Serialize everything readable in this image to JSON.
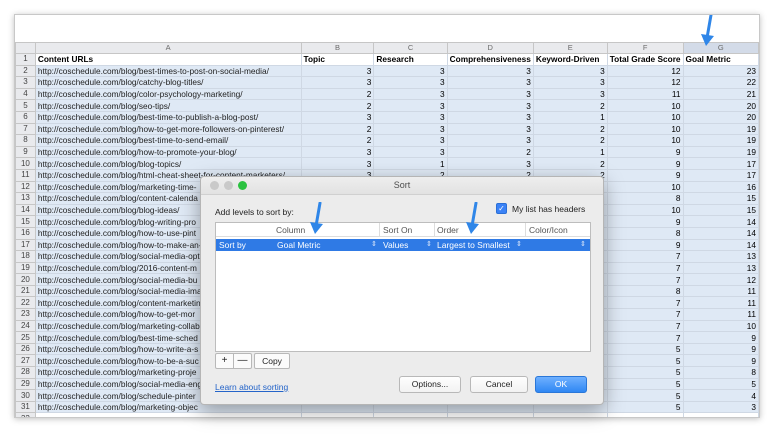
{
  "columns": [
    "A",
    "B",
    "C",
    "D",
    "E",
    "F",
    "G"
  ],
  "header_row": {
    "num": "1",
    "cells": [
      "Content URLs",
      "Topic",
      "Research",
      "Comprehensiveness",
      "Keyword-Driven",
      "Total Grade Score",
      "Goal Metric"
    ]
  },
  "rows": [
    {
      "n": "2",
      "url": "http://coschedule.com/blog/best-times-to-post-on-social-media/",
      "b": "3",
      "c": "3",
      "d": "3",
      "e": "3",
      "f": "12",
      "g": "23"
    },
    {
      "n": "3",
      "url": "http://coschedule.com/blog/catchy-blog-titles/",
      "b": "3",
      "c": "3",
      "d": "3",
      "e": "3",
      "f": "12",
      "g": "22"
    },
    {
      "n": "4",
      "url": "http://coschedule.com/blog/color-psychology-marketing/",
      "b": "2",
      "c": "3",
      "d": "3",
      "e": "3",
      "f": "11",
      "g": "21"
    },
    {
      "n": "5",
      "url": "http://coschedule.com/blog/seo-tips/",
      "b": "2",
      "c": "3",
      "d": "3",
      "e": "2",
      "f": "10",
      "g": "20"
    },
    {
      "n": "6",
      "url": "http://coschedule.com/blog/best-time-to-publish-a-blog-post/",
      "b": "3",
      "c": "3",
      "d": "3",
      "e": "1",
      "f": "10",
      "g": "20"
    },
    {
      "n": "7",
      "url": "http://coschedule.com/blog/how-to-get-more-followers-on-pinterest/",
      "b": "2",
      "c": "3",
      "d": "3",
      "e": "2",
      "f": "10",
      "g": "19"
    },
    {
      "n": "8",
      "url": "http://coschedule.com/blog/best-time-to-send-email/",
      "b": "2",
      "c": "3",
      "d": "3",
      "e": "2",
      "f": "10",
      "g": "19"
    },
    {
      "n": "9",
      "url": "http://coschedule.com/blog/how-to-promote-your-blog/",
      "b": "3",
      "c": "3",
      "d": "2",
      "e": "1",
      "f": "9",
      "g": "19"
    },
    {
      "n": "10",
      "url": "http://coschedule.com/blog/blog-topics/",
      "b": "3",
      "c": "1",
      "d": "3",
      "e": "2",
      "f": "9",
      "g": "17"
    },
    {
      "n": "11",
      "url": "http://coschedule.com/blog/html-cheat-sheet-for-content-marketers/",
      "b": "3",
      "c": "2",
      "d": "2",
      "e": "2",
      "f": "9",
      "g": "17"
    },
    {
      "n": "12",
      "url": "http://coschedule.com/blog/marketing-time-",
      "b": "",
      "c": "",
      "d": "",
      "e": "",
      "f": "10",
      "g": "16"
    },
    {
      "n": "13",
      "url": "http://coschedule.com/blog/content-calenda",
      "b": "",
      "c": "",
      "d": "",
      "e": "",
      "f": "8",
      "g": "15"
    },
    {
      "n": "14",
      "url": "http://coschedule.com/blog/blog-ideas/",
      "b": "",
      "c": "",
      "d": "",
      "e": "",
      "f": "10",
      "g": "15"
    },
    {
      "n": "15",
      "url": "http://coschedule.com/blog/blog-writing-pro",
      "b": "",
      "c": "",
      "d": "",
      "e": "",
      "f": "9",
      "g": "14"
    },
    {
      "n": "16",
      "url": "http://coschedule.com/blog/how-to-use-pint",
      "b": "",
      "c": "",
      "d": "",
      "e": "",
      "f": "8",
      "g": "14"
    },
    {
      "n": "17",
      "url": "http://coschedule.com/blog/how-to-make-an-",
      "b": "",
      "c": "",
      "d": "",
      "e": "",
      "f": "9",
      "g": "14"
    },
    {
      "n": "18",
      "url": "http://coschedule.com/blog/social-media-opt",
      "b": "",
      "c": "",
      "d": "",
      "e": "",
      "f": "7",
      "g": "13"
    },
    {
      "n": "19",
      "url": "http://coschedule.com/blog/2016-content-m",
      "b": "",
      "c": "",
      "d": "",
      "e": "",
      "f": "7",
      "g": "13"
    },
    {
      "n": "20",
      "url": "http://coschedule.com/blog/social-media-bu",
      "b": "",
      "c": "",
      "d": "",
      "e": "",
      "f": "7",
      "g": "12"
    },
    {
      "n": "21",
      "url": "http://coschedule.com/blog/social-media-ima",
      "b": "",
      "c": "",
      "d": "",
      "e": "",
      "f": "8",
      "g": "11"
    },
    {
      "n": "22",
      "url": "http://coschedule.com/blog/content-marketin",
      "b": "",
      "c": "",
      "d": "",
      "e": "",
      "f": "7",
      "g": "11"
    },
    {
      "n": "23",
      "url": "http://coschedule.com/blog/how-to-get-mor",
      "b": "",
      "c": "",
      "d": "",
      "e": "",
      "f": "7",
      "g": "11"
    },
    {
      "n": "24",
      "url": "http://coschedule.com/blog/marketing-collab",
      "b": "",
      "c": "",
      "d": "",
      "e": "",
      "f": "7",
      "g": "10"
    },
    {
      "n": "25",
      "url": "http://coschedule.com/blog/best-time-sched",
      "b": "",
      "c": "",
      "d": "",
      "e": "",
      "f": "7",
      "g": "9"
    },
    {
      "n": "26",
      "url": "http://coschedule.com/blog/how-to-write-a-s",
      "b": "",
      "c": "",
      "d": "",
      "e": "",
      "f": "5",
      "g": "9"
    },
    {
      "n": "27",
      "url": "http://coschedule.com/blog/how-to-be-a-suc",
      "b": "",
      "c": "",
      "d": "",
      "e": "",
      "f": "5",
      "g": "9"
    },
    {
      "n": "28",
      "url": "http://coschedule.com/blog/marketing-proje",
      "b": "",
      "c": "",
      "d": "",
      "e": "",
      "f": "5",
      "g": "8"
    },
    {
      "n": "29",
      "url": "http://coschedule.com/blog/social-media-eng",
      "b": "",
      "c": "",
      "d": "",
      "e": "",
      "f": "5",
      "g": "5"
    },
    {
      "n": "30",
      "url": "http://coschedule.com/blog/schedule-pinter",
      "b": "",
      "c": "",
      "d": "",
      "e": "",
      "f": "5",
      "g": "4"
    },
    {
      "n": "31",
      "url": "http://coschedule.com/blog/marketing-objec",
      "b": "",
      "c": "",
      "d": "",
      "e": "",
      "f": "5",
      "g": "3"
    }
  ],
  "last_row_num": "32",
  "dialog": {
    "title": "Sort",
    "add_levels_label": "Add levels to sort by:",
    "headers_checkbox_label": "My list has headers",
    "check_mark": "✓",
    "col_header_column": "Column",
    "col_header_sort_on": "Sort On",
    "col_header_order": "Order",
    "col_header_color": "Color/Icon",
    "row_sort_by": "Sort by",
    "row_column": "Goal Metric",
    "row_sort_on": "Values",
    "row_order": "Largest to Smallest",
    "plus": "+",
    "minus": "—",
    "copy": "Copy",
    "learn_link": "Learn about sorting",
    "options_button": "Options...",
    "cancel_button": "Cancel",
    "ok_button": "OK",
    "updown": "⇕"
  }
}
